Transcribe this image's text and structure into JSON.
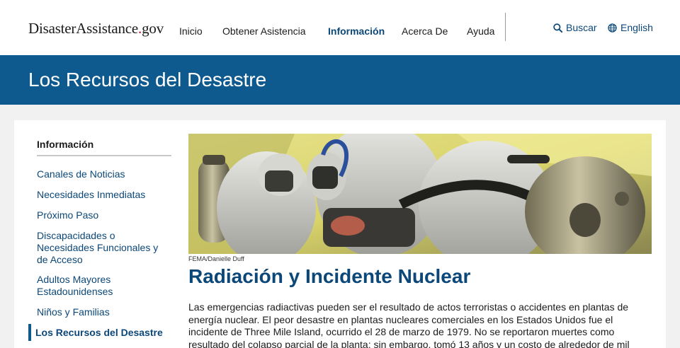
{
  "header": {
    "logo": {
      "main": "DisasterAssistance",
      "dot": ".",
      "tld": "gov"
    },
    "nav": [
      {
        "label": "Inicio",
        "active": false
      },
      {
        "label": "Obtener Asistencia",
        "active": false
      },
      {
        "label": "Información",
        "active": true
      },
      {
        "label": "Acerca De",
        "active": false
      },
      {
        "label": "Ayuda",
        "active": false
      }
    ],
    "search_label": "Buscar",
    "language_label": "English",
    "search_icon": "search-icon",
    "language_icon": "globe-icon"
  },
  "banner": {
    "title": "Los Recursos del Desastre"
  },
  "sidebar": {
    "heading": "Información",
    "items": [
      {
        "label": "Canales de Noticias"
      },
      {
        "label": "Necesidades Inmediatas"
      },
      {
        "label": "Próximo Paso"
      },
      {
        "label": "Discapacidades o Necesidades Funcionales y de Acceso"
      },
      {
        "label": "Adultos Mayores Estadounidenses"
      },
      {
        "label": "Niños y Familias"
      },
      {
        "label": "Los Recursos del Desastre",
        "current": true
      }
    ]
  },
  "article": {
    "image_credit": "FEMA/Danielle Duff",
    "title": "Radiación y Incidente Nuclear",
    "body": "Las emergencias radiactivas pueden ser el resultado de actos terroristas o accidentes en plantas de energía nuclear. El peor desastre en plantas nucleares comerciales en los Estados Unidos fue el incidente de Three Mile Island, ocurrido el 28 de marzo de 1979. No se reportaron muertes como resultado del colapso parcial de la planta; sin embargo, tomó 13 años y un costo de alrededor de mil millones de dólares para reparar el"
  },
  "colors": {
    "brand_blue": "#0e5a8e",
    "link_blue": "#0b4778",
    "logo_dot": "#c8102e"
  }
}
